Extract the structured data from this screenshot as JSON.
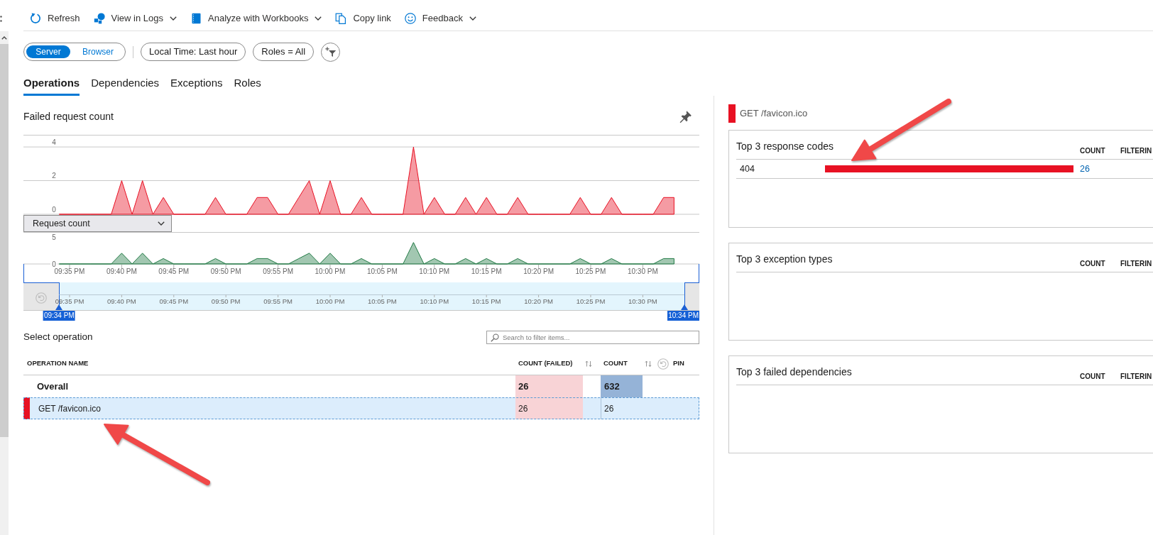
{
  "toolbar": [
    {
      "kind": "refresh",
      "label": "Refresh",
      "dropdown": false
    },
    {
      "kind": "logs",
      "label": "View in Logs",
      "dropdown": true
    },
    {
      "kind": "workbooks",
      "label": "Analyze with Workbooks",
      "dropdown": true
    },
    {
      "kind": "copy",
      "label": "Copy link",
      "dropdown": false
    },
    {
      "kind": "feedback",
      "label": "Feedback",
      "dropdown": true
    }
  ],
  "filters": {
    "segments": [
      {
        "label": "Server",
        "selected": true
      },
      {
        "label": "Browser",
        "selected": false
      }
    ],
    "pills": [
      "Local Time: Last hour",
      "Roles = All"
    ]
  },
  "tabs": [
    {
      "label": "Operations",
      "selected": true
    },
    {
      "label": "Dependencies",
      "selected": false
    },
    {
      "label": "Exceptions",
      "selected": false
    },
    {
      "label": "Roles",
      "selected": false
    }
  ],
  "failed_chart": {
    "chart_data": {
      "type": "area",
      "title": "Failed request count",
      "categories": [
        null,
        null,
        null,
        null,
        null,
        null,
        null,
        null,
        null,
        null,
        null,
        null,
        null,
        null,
        null,
        null,
        null,
        null,
        null,
        null,
        null,
        null,
        null,
        null,
        null,
        null,
        null,
        null,
        null,
        null,
        null,
        null,
        null,
        null,
        null,
        null,
        null,
        null,
        null,
        null,
        null,
        null,
        null,
        null,
        null,
        null,
        null,
        null,
        null,
        null,
        null,
        null,
        null,
        null,
        null,
        null,
        null,
        null,
        null,
        null
      ],
      "ylim": [
        0,
        4.7
      ],
      "yticks": [
        0,
        2,
        4
      ],
      "series": [
        {
          "color": "#e81123",
          "values": [
            0,
            0,
            0,
            0,
            0,
            0,
            2,
            0,
            2,
            0,
            1,
            0,
            0,
            0,
            0,
            1,
            0,
            0,
            0,
            1,
            1,
            0,
            0,
            1,
            2,
            0,
            2,
            0,
            0,
            1,
            0,
            0,
            0,
            0,
            4,
            0,
            1,
            0,
            0,
            1,
            0,
            1,
            0,
            0,
            1,
            0,
            0,
            0,
            0,
            0,
            1,
            0,
            0,
            1,
            0,
            0,
            0,
            0,
            1,
            1
          ]
        }
      ]
    }
  },
  "metric_dropdown": {
    "value": "Request count"
  },
  "request_chart": {
    "chart_data": {
      "type": "area",
      "categories": [
        null,
        "09:35 PM",
        null,
        null,
        null,
        null,
        "09:40 PM",
        null,
        null,
        null,
        null,
        "09:45 PM",
        null,
        null,
        null,
        null,
        "09:50 PM",
        null,
        null,
        null,
        null,
        "09:55 PM",
        null,
        null,
        null,
        null,
        "10:00 PM",
        null,
        null,
        null,
        null,
        "10:05 PM",
        null,
        null,
        null,
        null,
        "10:10 PM",
        null,
        null,
        null,
        null,
        "10:15 PM",
        null,
        null,
        null,
        null,
        "10:20 PM",
        null,
        null,
        null,
        null,
        "10:25 PM",
        null,
        null,
        null,
        null,
        "10:30 PM",
        null,
        null,
        null
      ],
      "ylim": [
        0,
        5.8
      ],
      "yticks": [
        0,
        5
      ],
      "series": [
        {
          "color": "#217a45",
          "values": [
            0,
            0,
            0,
            0,
            0,
            0,
            2,
            0,
            2,
            0,
            1,
            0,
            0,
            0,
            0,
            1,
            0,
            0,
            0,
            1,
            1,
            0,
            0,
            1,
            2,
            0,
            2,
            0,
            0,
            1,
            0,
            0,
            0,
            0,
            4,
            0,
            1,
            0,
            0,
            1,
            0,
            1,
            0,
            0,
            1,
            0,
            0,
            0,
            0,
            0,
            1,
            0,
            0,
            1,
            0,
            0,
            0,
            0,
            1,
            1
          ]
        }
      ]
    }
  },
  "time_brush": {
    "labels": [
      "09:35 PM",
      "09:40 PM",
      "09:45 PM",
      "09:50 PM",
      "09:55 PM",
      "10:00 PM",
      "10:05 PM",
      "10:10 PM",
      "10:15 PM",
      "10:20 PM",
      "10:25 PM",
      "10:30 PM"
    ],
    "start_label": "09:34 PM",
    "end_label": "10:34 PM"
  },
  "operations": {
    "title": "Select operation",
    "search": {
      "placeholder": "Search to filter items..."
    },
    "columns": [
      {
        "label": "OPERATION NAME",
        "kind": "name"
      },
      {
        "label": "COUNT (FAILED)",
        "kind": "sortable"
      },
      {
        "label": "COUNT",
        "kind": "sortable"
      },
      {
        "label": "PIN",
        "kind": "pin"
      }
    ],
    "rows": [
      {
        "kind": "total",
        "name": "Overall",
        "count_failed": "26",
        "count": "632",
        "selected": false
      },
      {
        "kind": "operation",
        "name": "GET /favicon.ico",
        "count_failed": "26",
        "count": "26",
        "selected": true,
        "color": "#e81123"
      }
    ]
  },
  "detail": {
    "title": "GET /favicon.ico",
    "color": "#e81123",
    "cards": [
      {
        "title": "Top 3 response codes",
        "columns": [
          "COUNT",
          "FILTERIN"
        ],
        "rows": [
          {
            "label": "404",
            "level": 1,
            "count": "26"
          }
        ]
      },
      {
        "title": "Top 3 exception types",
        "columns": [
          "COUNT",
          "FILTERIN"
        ]
      },
      {
        "title": "Top 3 failed dependencies",
        "columns": [
          "COUNT",
          "FILTERIN"
        ]
      }
    ]
  }
}
